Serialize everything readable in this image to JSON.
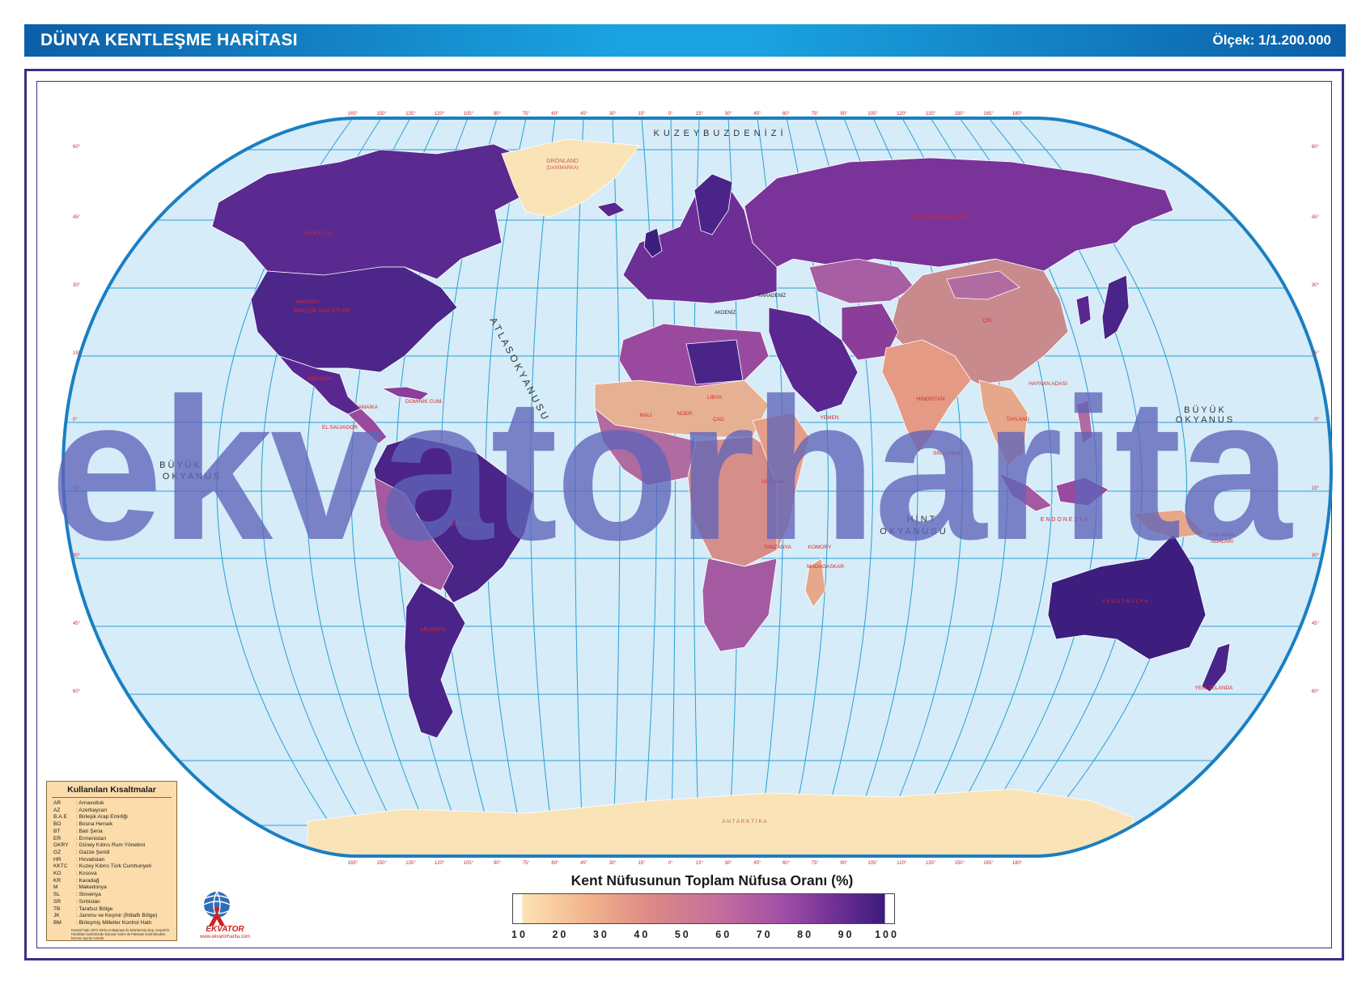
{
  "header": {
    "title": "DÜNYA KENTLEŞME HARİTASI",
    "scale": "Ölçek: 1/1.200.000"
  },
  "map": {
    "colors": {
      "ocean": "#d6ecf8",
      "grid": "#2aa0d6",
      "border": "#1a7fc2",
      "ice": "#fbe3b8",
      "label": "#d42a2a"
    },
    "sea_labels": {
      "arctic": "K U Z E Y   B U Z   D E N İ Z İ",
      "atlantic": "A T L A S   O K Y A N U S U",
      "pacific_west_1": "B Ü Y Ü K",
      "pacific_west_2": "O K Y A N U S",
      "pacific_east_1": "B Ü Y Ü K",
      "pacific_east_2": "O K Y A N U S",
      "indian_1": "H İ N T",
      "indian_2": "O K Y A N U S U",
      "mediterranean": "AKDENİZ",
      "black_sea": "KARADENİZ",
      "greenland": "GRÖNLAND",
      "greenland_sub": "(DANİMARKA)",
      "antarctica": "A N T A R K T İ K A"
    },
    "country_labels": {
      "usa_1": "AMERİKA",
      "usa_2": "BİRLEŞİK DEVLETLERİ",
      "canada": "K A N A D A",
      "russia": "RUSYA FEDERASYONU",
      "china": "ÇİN",
      "australia": "A V U S T R A L Y A",
      "new_zealand": "YENİ ZELANDA",
      "libya": "LİBYA",
      "chad": "ÇAD",
      "niger": "NİJER",
      "mali": "MALİ",
      "tanzania": "TANZANYA",
      "madagascar": "MADAGASKAR",
      "argentina": "ARJANTİN",
      "brazil": "BREZİLYA",
      "india": "HİNDİSTAN",
      "sri_lanka": "SRİ LANKA",
      "uganda": "UGANDA",
      "yemen": "YEMEN",
      "thailand": "TAYLAND",
      "comoros": "KOMORY",
      "mexico": "MEKSİKA",
      "dominican": "DOMİNİK CUM.",
      "jamaica": "JAMAİKA",
      "el_salvador": "EL SALVADOR",
      "hainan": "HAYNAN ADASI",
      "solomon_1": "SOLOMON",
      "solomon_2": "ADALARI",
      "indonesia": "E N D O N E Z Y A"
    },
    "lat_labels": [
      "60°",
      "45°",
      "30°",
      "15°",
      "0°",
      "15°",
      "30°",
      "45°",
      "60°"
    ],
    "lon_labels": [
      "165°",
      "150°",
      "135°",
      "120°",
      "105°",
      "90°",
      "75°",
      "60°",
      "45°",
      "30°",
      "15°",
      "0°",
      "15°",
      "30°",
      "45°",
      "60°",
      "75°",
      "90°",
      "105°",
      "120°",
      "135°",
      "150°",
      "165°",
      "180°"
    ]
  },
  "abbreviations": {
    "title": "Kullanılan Kısaltmalar",
    "items": [
      {
        "code": "AR",
        "name": ": Arnavutluk"
      },
      {
        "code": "AZ",
        "name": ": Azerbaycan"
      },
      {
        "code": "B.A.E",
        "name": ": Birleşik Arap Emirliği"
      },
      {
        "code": "BO",
        "name": ": Bosna Hersek"
      },
      {
        "code": "BT",
        "name": ": Batı Şeria"
      },
      {
        "code": "ER",
        "name": ": Ermenistan"
      },
      {
        "code": "GKRY",
        "name": ": Güney Kıbrıs Rum Yönetimi"
      },
      {
        "code": "GZ",
        "name": ": Gazze Şeridi"
      },
      {
        "code": "HR",
        "name": ": Hırvatistan"
      },
      {
        "code": "KKTC",
        "name": ": Kuzey Kıbrıs Türk Cumhuriyeti"
      },
      {
        "code": "KO",
        "name": ": Kosova"
      },
      {
        "code": "KR",
        "name": ": Karadağ"
      },
      {
        "code": "M",
        "name": ": Makedonya"
      },
      {
        "code": "SL",
        "name": ": Slovenya"
      },
      {
        "code": "SR",
        "name": ": Sırbistan"
      },
      {
        "code": "TB",
        "name": ": Tarafsız Bölge"
      },
      {
        "code": "JK",
        "name": ": Jammu ve Keşmir (İhtilaflı Bölge)"
      },
      {
        "code": "BM",
        "name": ": Birleşmiş Milletler Kontrol Hattı"
      }
    ],
    "note": "Kontrol hattı 1972 Simla Antlaşması ile belirlenmiş olup, Keşmir'in Hindistan kontrolünde bulunan kısmı ile Pakistan kontrolündeki kısmını ayıran sınırdır."
  },
  "logo": {
    "name": "EKVATOR",
    "url": "www.ekvatorharita.com"
  },
  "legend": {
    "title": "Kent Nüfusunun Toplam Nüfusa Oranı (%)",
    "ticks": [
      "10",
      "20",
      "30",
      "40",
      "50",
      "60",
      "70",
      "80",
      "90",
      "100"
    ],
    "gradient": [
      "#fde2b4",
      "#f2b48c",
      "#dd8a86",
      "#c36d9e",
      "#a14ea6",
      "#6d2f95",
      "#3a1a7c"
    ]
  },
  "watermark": "ekvatorharita"
}
